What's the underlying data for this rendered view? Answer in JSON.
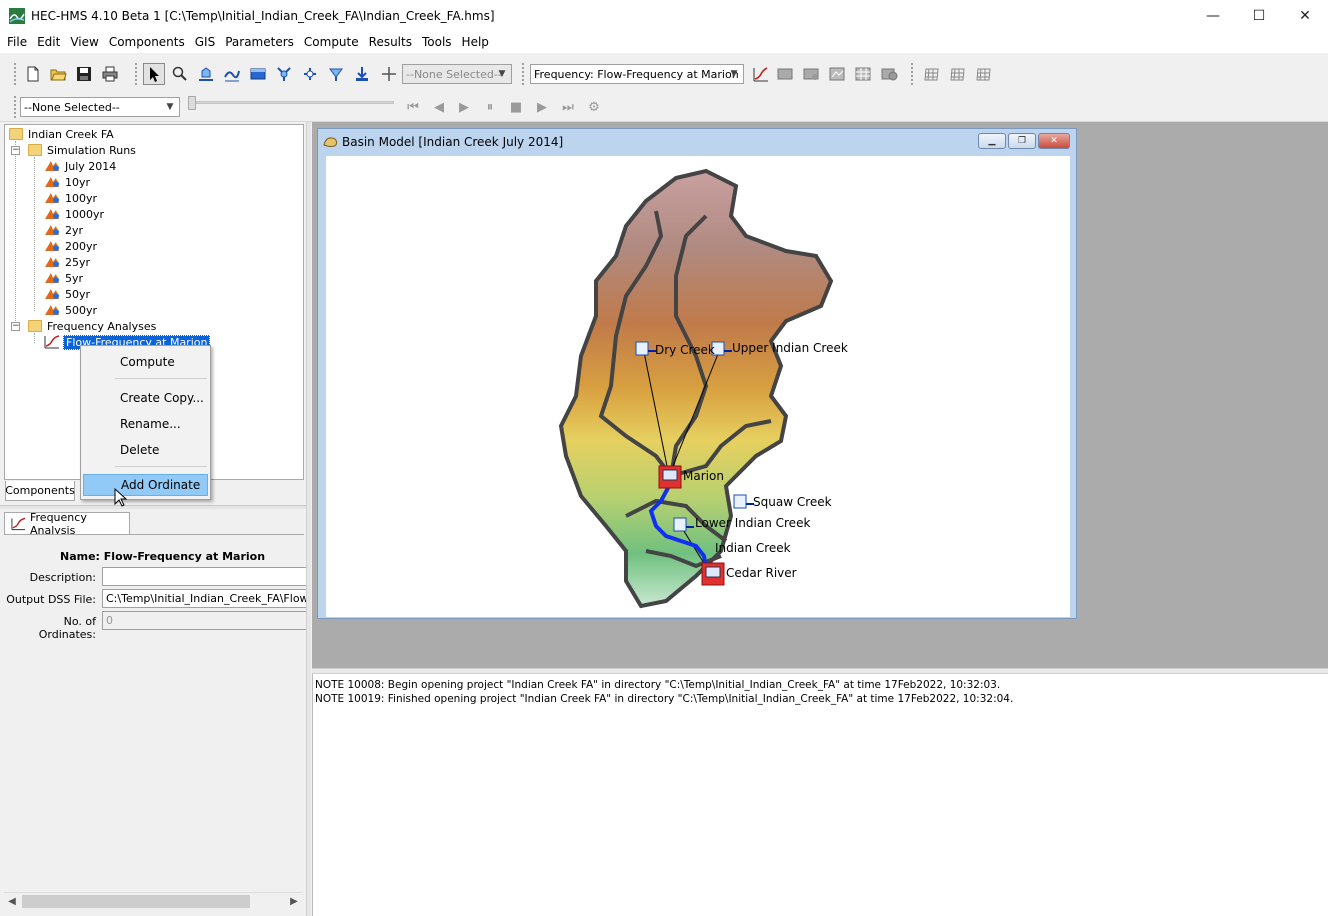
{
  "window": {
    "title": "HEC-HMS 4.10 Beta 1 [C:\\Temp\\Initial_Indian_Creek_FA\\Indian_Creek_FA.hms]",
    "minimize": "—",
    "maximize": "☐",
    "close": "✕"
  },
  "menubar": [
    "File",
    "Edit",
    "View",
    "Components",
    "GIS",
    "Parameters",
    "Compute",
    "Results",
    "Tools",
    "Help"
  ],
  "toolbar": {
    "element_combo": "--None Selected--",
    "run_combo": "Frequency: Flow-Frequency at Marion",
    "time_combo": "--None Selected--"
  },
  "tree": {
    "root": "Indian Creek FA",
    "simulation_runs": "Simulation Runs",
    "runs": [
      "July 2014",
      "10yr",
      "100yr",
      "1000yr",
      "2yr",
      "200yr",
      "25yr",
      "5yr",
      "50yr",
      "500yr"
    ],
    "frequency_analyses": "Frequency Analyses",
    "analyses": [
      "Flow-Frequency at Marion"
    ]
  },
  "tabs": {
    "components": "Components"
  },
  "context_menu": [
    "Compute",
    "Create Copy...",
    "Rename...",
    "Delete",
    "Add Ordinate"
  ],
  "editor": {
    "tab": "Frequency Analysis",
    "name_label": "Name:",
    "name_value": "Flow-Frequency at Marion",
    "description_label": "Description:",
    "description_value": "",
    "output_label": "Output DSS File:",
    "output_value": "C:\\Temp\\Initial_Indian_Creek_FA\\Flow_Fr",
    "ordinates_label": "No. of Ordinates:",
    "ordinates_value": "0"
  },
  "basin_window": {
    "title": "Basin Model [Indian Creek July 2014]",
    "labels": [
      "Dry Creek",
      "Upper Indian Creek",
      "Marion",
      "Squaw Creek",
      "Lower Indian Creek",
      "Indian Creek",
      "Cedar River"
    ]
  },
  "log": [
    "NOTE 10008:  Begin opening project \"Indian Creek FA\" in directory \"C:\\Temp\\Initial_Indian_Creek_FA\" at time 17Feb2022, 10:32:03.",
    "NOTE 10019:  Finished opening project \"Indian Creek FA\" in directory \"C:\\Temp\\Initial_Indian_Creek_FA\" at time 17Feb2022, 10:32:04."
  ]
}
